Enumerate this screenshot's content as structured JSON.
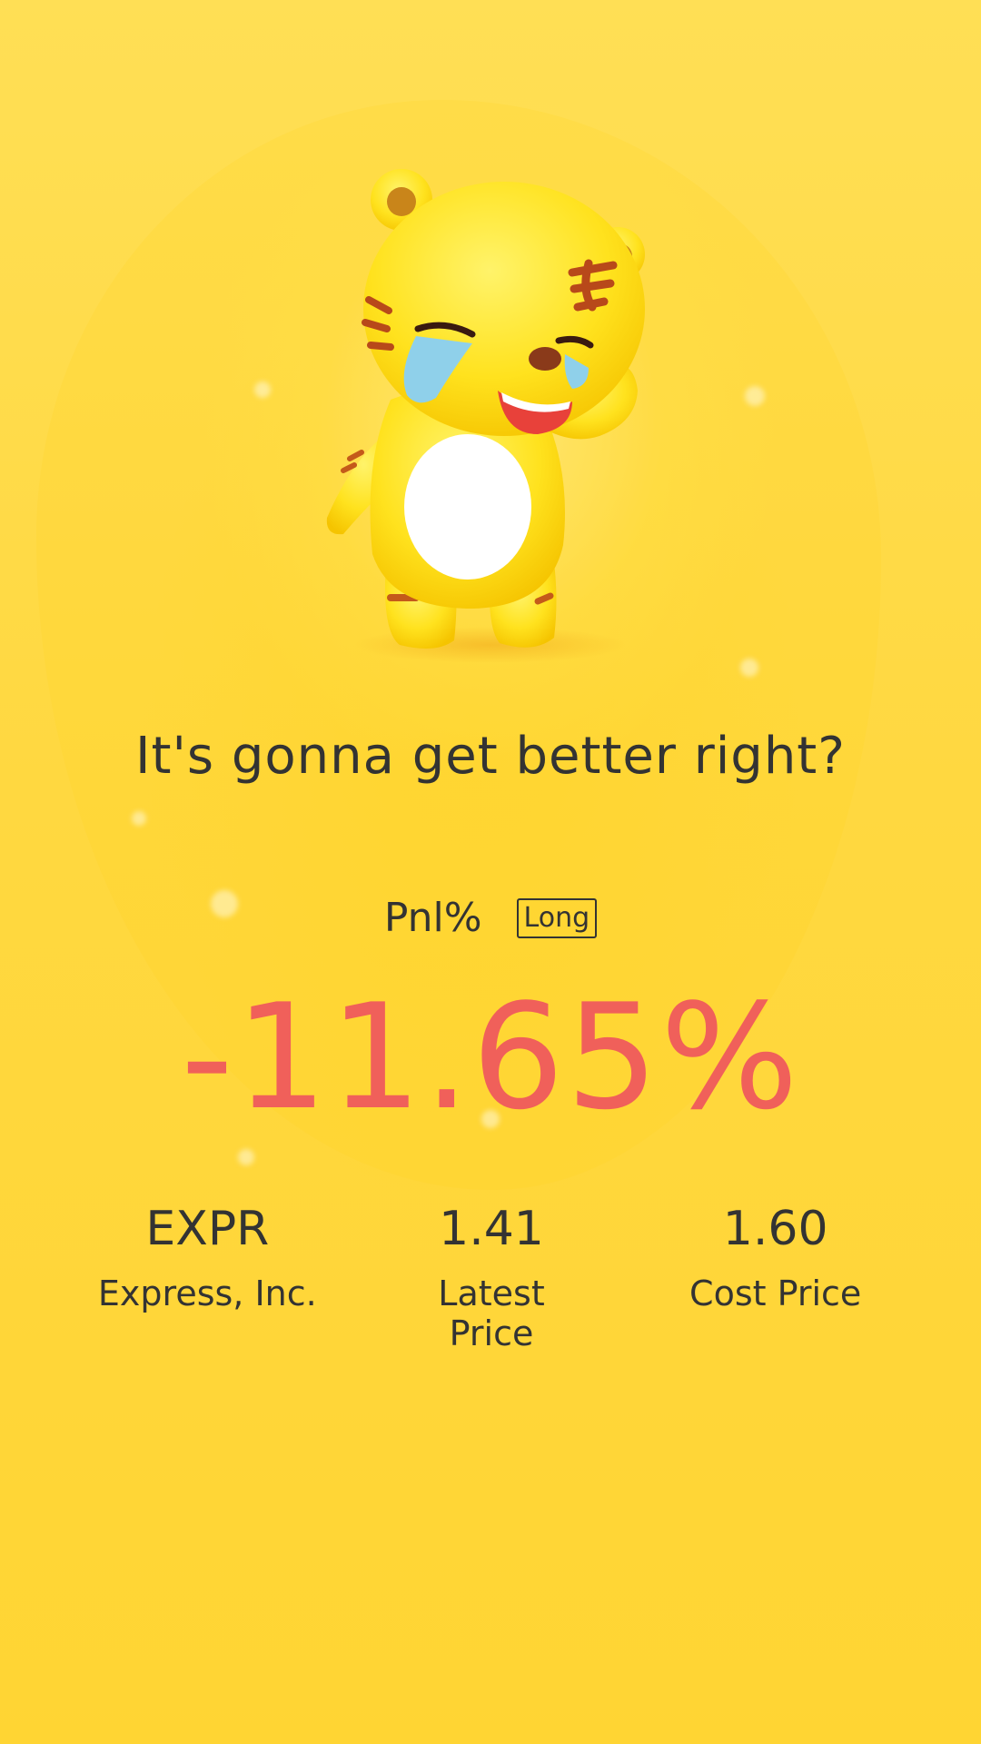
{
  "headline": "It's gonna get better right?",
  "pnl": {
    "label": "Pnl%",
    "position_type": "Long",
    "value": "-11.65%",
    "value_color": "#f0605a"
  },
  "stats": [
    {
      "value": "EXPR",
      "label": "Express, Inc."
    },
    {
      "value": "1.41",
      "label": "Latest Price"
    },
    {
      "value": "1.60",
      "label": "Cost Price"
    }
  ],
  "mascot": {
    "icon": "crying-tiger-mascot-icon"
  },
  "colors": {
    "background": "#ffd633",
    "text": "#333333",
    "loss": "#f0605a"
  }
}
